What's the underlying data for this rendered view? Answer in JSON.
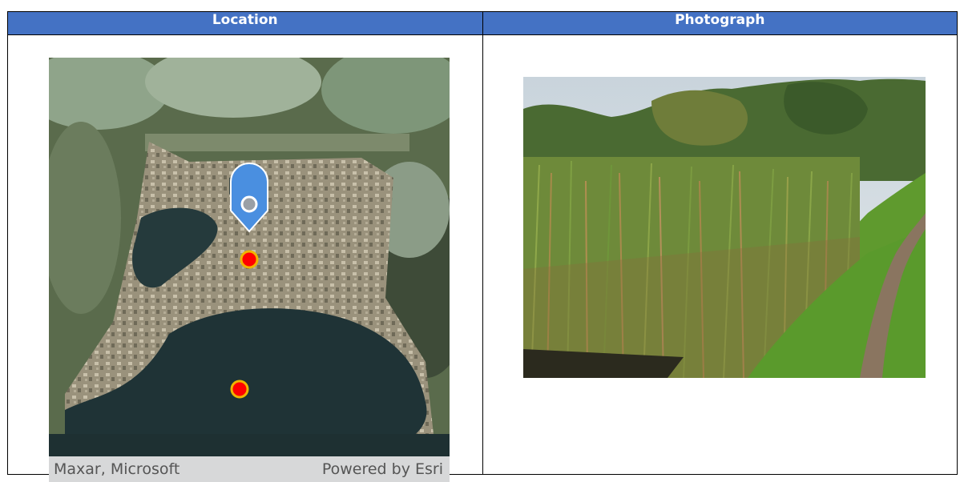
{
  "table": {
    "headers": [
      "Location",
      "Photograph"
    ]
  },
  "map": {
    "attribution_left": "Maxar, Microsoft",
    "attribution_right": "Powered by Esri",
    "marker_icon": "map-pin-icon",
    "point_color": "#ff0000",
    "pin_color": "#4a8fe0"
  },
  "colors": {
    "header_bg": "#4472c4",
    "header_text": "#ffffff"
  }
}
